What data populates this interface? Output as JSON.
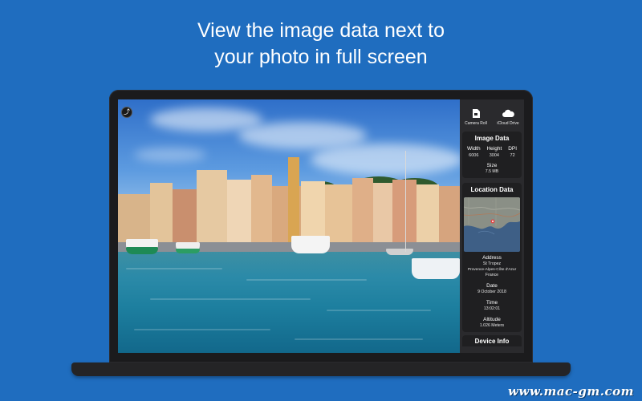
{
  "headline": {
    "line1": "View the image data next to",
    "line2": "your photo in full screen"
  },
  "toolbar": {
    "export_icon": "share-icon"
  },
  "sources": [
    {
      "label": "Camera Roll",
      "icon": "camera-roll-icon"
    },
    {
      "label": "iCloud Drive",
      "icon": "cloud-icon"
    }
  ],
  "image_data": {
    "title": "Image Data",
    "width_label": "Width",
    "width_value": "6006",
    "height_label": "Height",
    "height_value": "3004",
    "dpi_label": "DPI",
    "dpi_value": "72",
    "size_label": "Size",
    "size_value": "7.5 MB"
  },
  "location_data": {
    "title": "Location Data",
    "address_label": "Address",
    "address_line1": "St Tropez",
    "address_line2": "Provence-Alpes-Côte d'Azur",
    "address_line3": "France",
    "date_label": "Date",
    "date_value": "9 October 2018",
    "time_label": "Time",
    "time_value": "13:02:01",
    "altitude_label": "Altitude",
    "altitude_value": "1.026 Meters"
  },
  "device_info": {
    "title": "Device Info"
  },
  "colors": {
    "background": "#1f6dbf",
    "sidebar": "#2a2a2d",
    "card": "#1f1f21"
  },
  "watermark": "www.mac-gm.com"
}
